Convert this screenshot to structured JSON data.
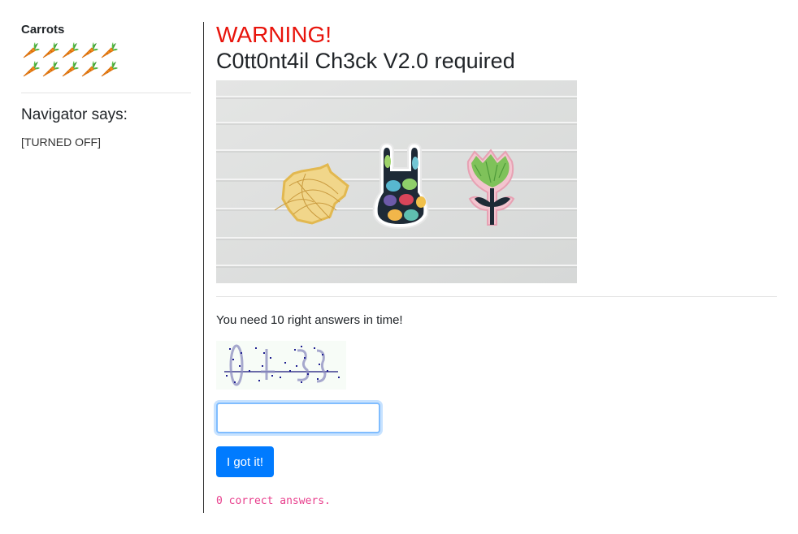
{
  "sidebar": {
    "title": "Carrots",
    "carrot_count": 10,
    "carrot_icon": "carrot-icon",
    "navigator_heading": "Navigator says:",
    "navigator_status": "[TURNED OFF]"
  },
  "main": {
    "warning": "WARNING!",
    "requirement": "C0tt0nt4il Ch3ck V2.0 required",
    "image_icon": "easter-cookie-cutters-photo",
    "instructions": "You need 10 right answers in time!",
    "captcha_icon": "captcha-image",
    "answer_value": "",
    "answer_placeholder": "",
    "submit_label": "I got it!",
    "score_text": "0 correct answers."
  },
  "colors": {
    "warning": "#e8140c",
    "button": "#007bff",
    "score": "#e83e8c",
    "focus": "#80bdff"
  }
}
